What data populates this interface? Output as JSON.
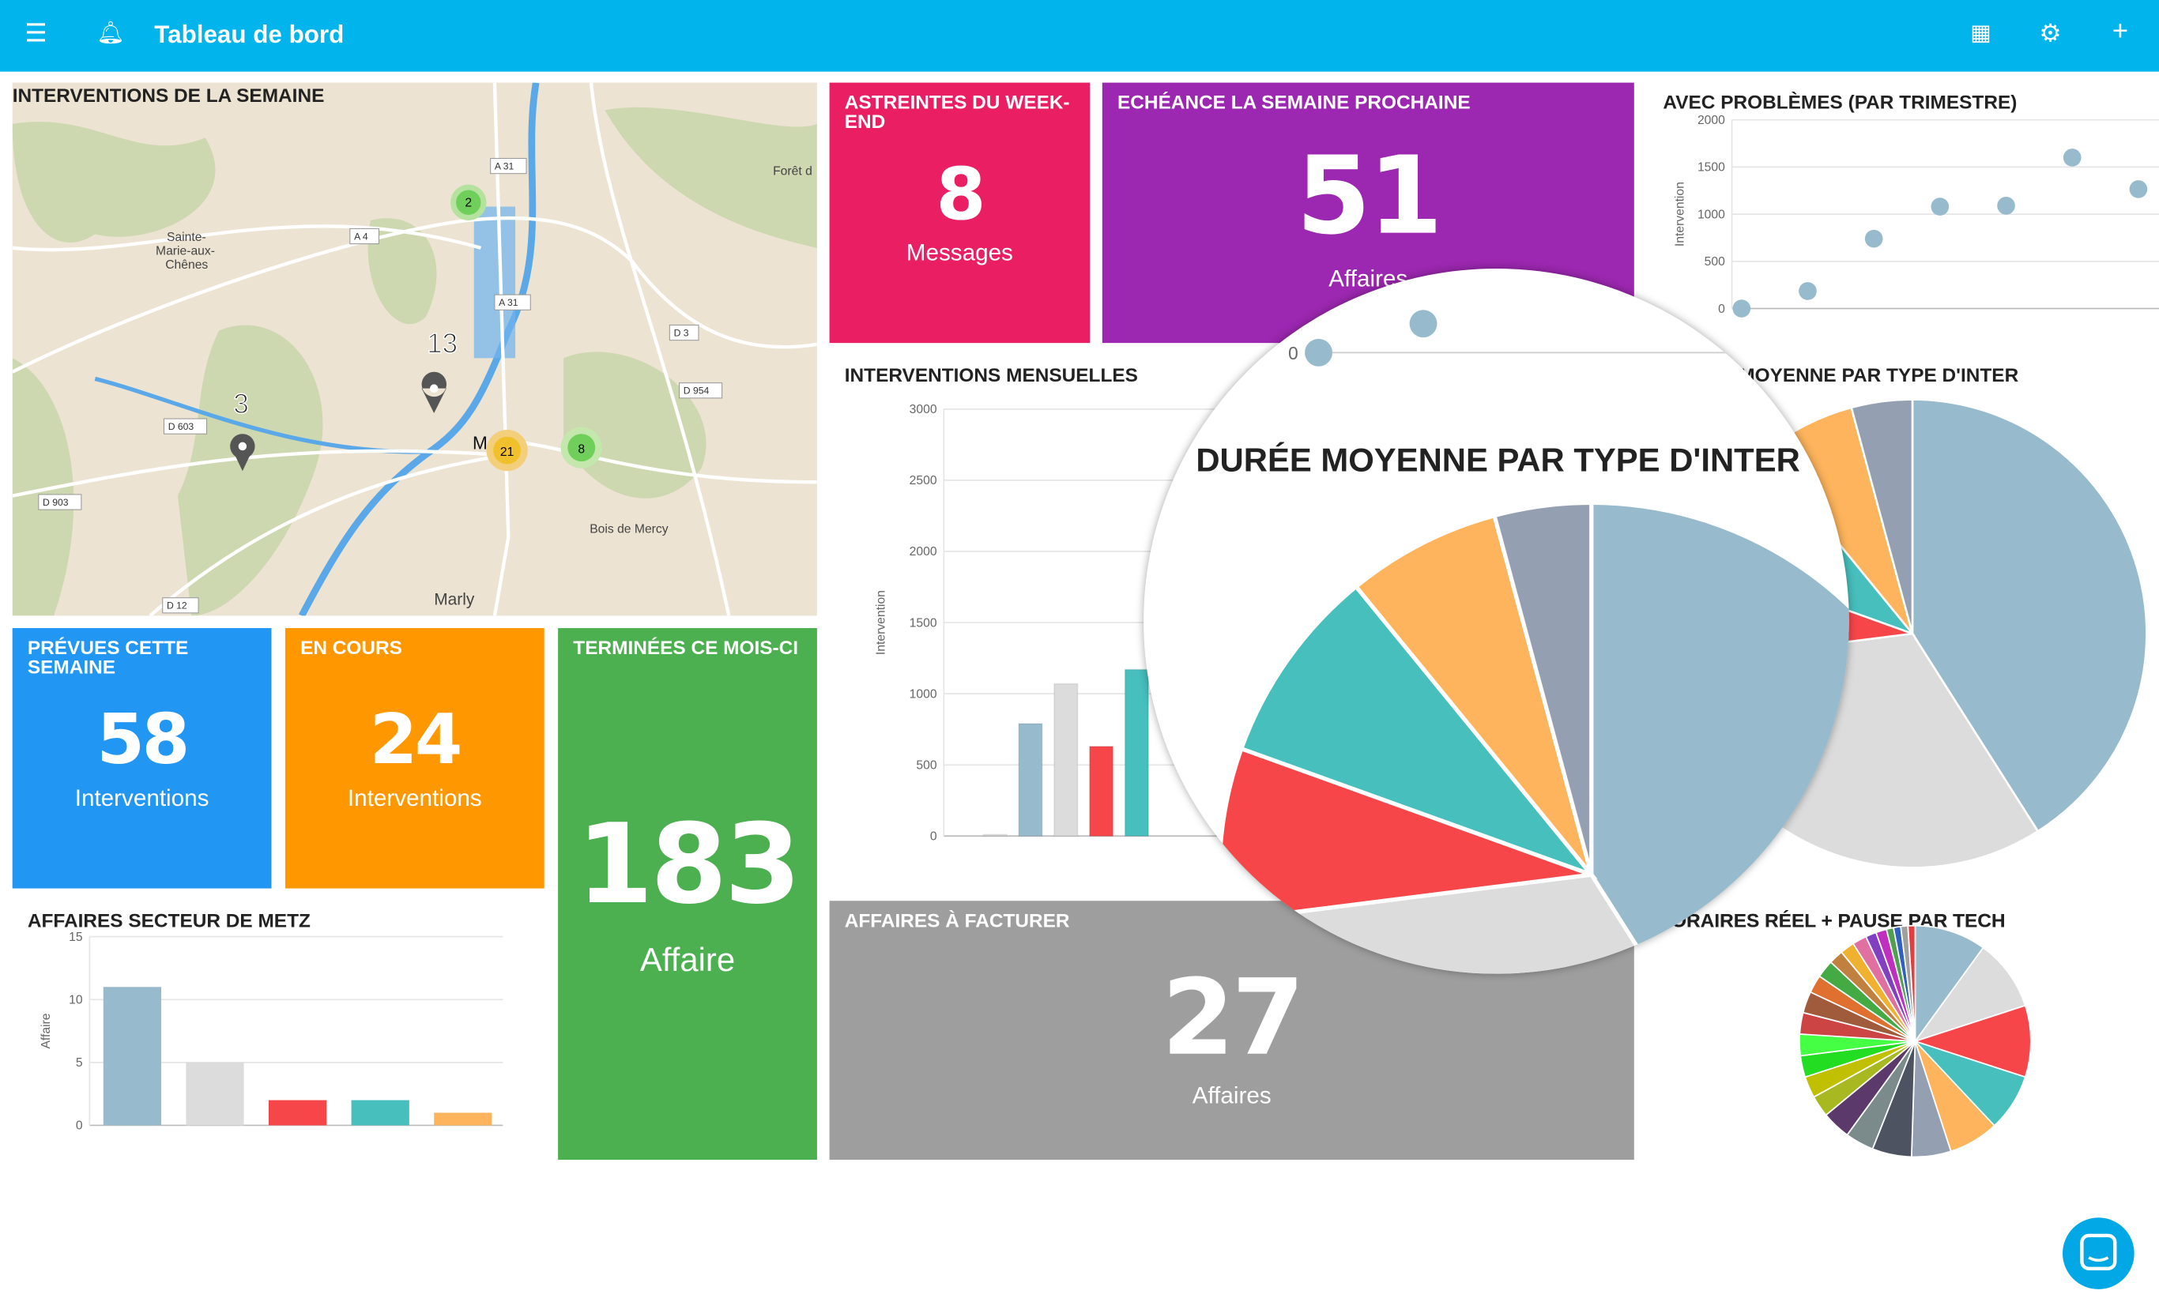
{
  "header": {
    "title": "Tableau de bord",
    "icons": [
      "menu-icon",
      "bell-icon",
      "dashboard-icon",
      "gear-icon",
      "plus-icon"
    ],
    "color": "#02b4ec"
  },
  "map": {
    "title": "INTERVENTIONS DE LA SEMAINE",
    "places": [
      "Sainte-",
      "Marie-aux-",
      "Chênes",
      "Marly",
      "Bois de Mercy",
      "Forêt d",
      "Metz"
    ],
    "roads": [
      "A 31",
      "A 31",
      "A 4",
      "D 3",
      "D 954",
      "D 603",
      "D 903",
      "D 12"
    ],
    "clusters": [
      "2",
      "21",
      "8"
    ],
    "markers": [
      "13",
      "3"
    ]
  },
  "astreintes": {
    "title": "ASTREINTES DU WEEK-END",
    "value": "8",
    "unit": "Messages",
    "color": "#e91e63"
  },
  "echeance": {
    "title": "ECHÉANCE LA SEMAINE PROCHAINE",
    "value": "51",
    "unit": "Affaires",
    "color": "#9c27b0"
  },
  "prevues": {
    "title": "PRÉVUES CETTE SEMAINE",
    "value": "58",
    "unit": "Interventions",
    "color": "#2196f3"
  },
  "encours": {
    "title": "EN COURS",
    "value": "24",
    "unit": "Interventions",
    "color": "#ff9800"
  },
  "terminees": {
    "title": "TERMINÉES CE MOIS-CI",
    "value": "183",
    "unit": "Affaire",
    "color": "#4caf50"
  },
  "facturer": {
    "title": "AFFAIRES À FACTURER",
    "value": "27",
    "unit": "Affaires",
    "color": "#9e9e9e"
  },
  "palette": [
    "#97bbcd",
    "#dcdcdc",
    "#f7464a",
    "#46bfbd",
    "#fdb45c",
    "#949fb1",
    "#4d5360",
    "#2e9e2e"
  ],
  "chart_data": [
    {
      "id": "problemes",
      "type": "scatter",
      "title": "AVEC PROBLÈMES (PAR TRIMESTRE)",
      "ylabel": "Intervention",
      "ylim": [
        0,
        2000
      ],
      "yticks": [
        "0",
        "500",
        "1000",
        "1500",
        "2000"
      ],
      "values": [
        0,
        185,
        740,
        1080,
        1090,
        1600,
        1265
      ],
      "grid": true
    },
    {
      "id": "mensuelles",
      "type": "bar",
      "title": "INTERVENTIONS MENSUELLES",
      "ylabel": "Intervention",
      "ylim": [
        0,
        3000
      ],
      "yticks": [
        "0",
        "500",
        "1000",
        "1500",
        "2000",
        "2500",
        "3000"
      ],
      "values": [
        0,
        10,
        790,
        1070,
        630,
        1170
      ],
      "grid": true
    },
    {
      "id": "duree",
      "type": "pie",
      "title": "DURÉE MOYENNE PAR TYPE D'INTER",
      "title_partial": "MOYENNE PAR TYPE D'INTER",
      "shares": [
        41,
        32,
        7.5,
        8.6,
        6.7,
        4.2
      ]
    },
    {
      "id": "secteur",
      "type": "bar",
      "title": "AFFAIRES SECTEUR DE METZ",
      "ylabel": "Affaire",
      "ylim": [
        0,
        15
      ],
      "yticks": [
        "0",
        "5",
        "10",
        "15"
      ],
      "values": [
        11,
        5,
        2,
        2,
        1
      ],
      "grid": true
    },
    {
      "id": "horaires",
      "type": "pie",
      "title": "HORAIRES RÉEL + PAUSE PAR TECH",
      "title_partial": "ORAIRES RÉEL + PAUSE PAR TECH",
      "shares": [
        10,
        10,
        10,
        8,
        7,
        5.5,
        5.5,
        4,
        4,
        3,
        3,
        3,
        3,
        3,
        3,
        2.5,
        2.5,
        2,
        2,
        2,
        1.5,
        1.5,
        1,
        1,
        1,
        1
      ],
      "colors": [
        "#97bbcd",
        "#dcdcdc",
        "#f7464a",
        "#46bfbd",
        "#fdb45c",
        "#949fb1",
        "#4d5360",
        "#7b8a8b",
        "#5b3a6b",
        "#a8b820",
        "#c0c000",
        "#22dd22",
        "#44ff44",
        "#cc4444",
        "#a05a3c",
        "#e07030",
        "#44aa44",
        "#c08040",
        "#f0b030",
        "#e070a0",
        "#8040c0",
        "#c030c0",
        "#50a050",
        "#3060c0",
        "#a0a0a0",
        "#e04040"
      ]
    }
  ],
  "magnifier": {
    "scatter_zero": "0"
  }
}
